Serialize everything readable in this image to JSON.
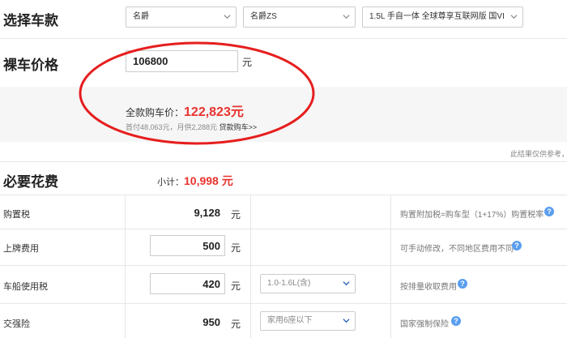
{
  "select_car": {
    "label": "选择车款",
    "brand": "名爵",
    "series": "名爵ZS",
    "model": "1.5L 手自一体 全球尊享互联网版 国VI"
  },
  "bare_price": {
    "label": "裸车价格",
    "value": "106800",
    "unit": "元"
  },
  "full_price": {
    "label": "全款购车价：",
    "value": "122,823元",
    "sub_text": "首付48,063元，月供2,288元",
    "loan_link": "贷款购车>>"
  },
  "disclaimer": "此结果仅供参考，",
  "required_fees": {
    "label": "必要花费",
    "subtotal_label": "小计：",
    "subtotal_value": "10,998 元"
  },
  "fees": [
    {
      "name": "购置税",
      "value": "9,128",
      "unit": "元",
      "note": "购置附加税=购车型（1+17%）购置税率"
    },
    {
      "name": "上牌费用",
      "value": "500",
      "unit": "元",
      "note": "可手动修改，不同地区费用不同"
    },
    {
      "name": "车船使用税",
      "value": "420",
      "unit": "元",
      "option": "1.0-1.6L(含)",
      "note": "按排量收取费用"
    },
    {
      "name": "交强险",
      "value": "950",
      "unit": "元",
      "option": "家用6座以下",
      "note": "国家强制保险"
    }
  ],
  "colors": {
    "accent_red": "#e8332e",
    "help_blue": "#5a9ef0",
    "oval": "#e61e1e"
  }
}
